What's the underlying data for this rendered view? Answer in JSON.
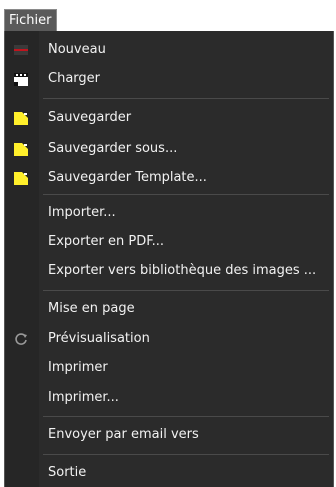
{
  "menubar": {
    "title": "Fichier"
  },
  "menu": {
    "items": [
      {
        "label": "Nouveau",
        "icon": "new-document-icon"
      },
      {
        "label": "Charger",
        "icon": "load-icon"
      },
      {
        "label": "Sauvegarder",
        "icon": "save-icon"
      },
      {
        "label": "Sauvegarder sous...",
        "icon": "save-as-icon"
      },
      {
        "label": "Sauvegarder Template...",
        "icon": "save-template-icon"
      },
      {
        "label": "Importer..."
      },
      {
        "label": "Exporter en PDF..."
      },
      {
        "label": "Exporter vers bibliothèque des images ..."
      },
      {
        "label": "Mise en page"
      },
      {
        "label": "Prévisualisation",
        "icon": "preview-refresh-icon"
      },
      {
        "label": "Imprimer"
      },
      {
        "label": "Imprimer..."
      },
      {
        "label": "Envoyer par email vers"
      },
      {
        "label": "Sortie"
      }
    ]
  },
  "colors": {
    "menu_bg": "#2b2b2b",
    "menu_text": "#f2f2f2",
    "save_icon": "#ffef2b",
    "new_icon": "#c0141e"
  }
}
